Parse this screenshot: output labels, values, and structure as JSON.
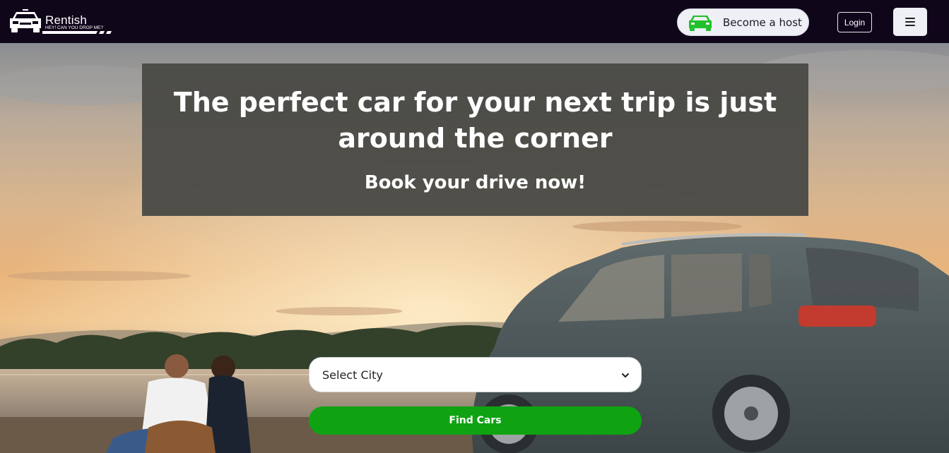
{
  "brand": {
    "name": "Rentish",
    "tagline": "HEY! CAN YOU DROP ME?",
    "logo_icon": "car-logo-icon"
  },
  "nav": {
    "become_host_label": "Become a host",
    "become_host_icon": "green-car-icon",
    "login_label": "Login",
    "menu_icon": "hamburger-menu-icon"
  },
  "hero": {
    "headline": "The perfect car for your next trip is just around the corner",
    "subheadline": "Book your drive now!",
    "background": "sunset-lake-with-couple-and-suv-photo"
  },
  "search": {
    "city_select_value": "Select City",
    "find_button_label": "Find Cars"
  },
  "colors": {
    "nav_bg": "#10061a",
    "accent_green": "#0fa312",
    "host_icon_green": "#22c02b",
    "headline_box": "#4a4a46"
  }
}
